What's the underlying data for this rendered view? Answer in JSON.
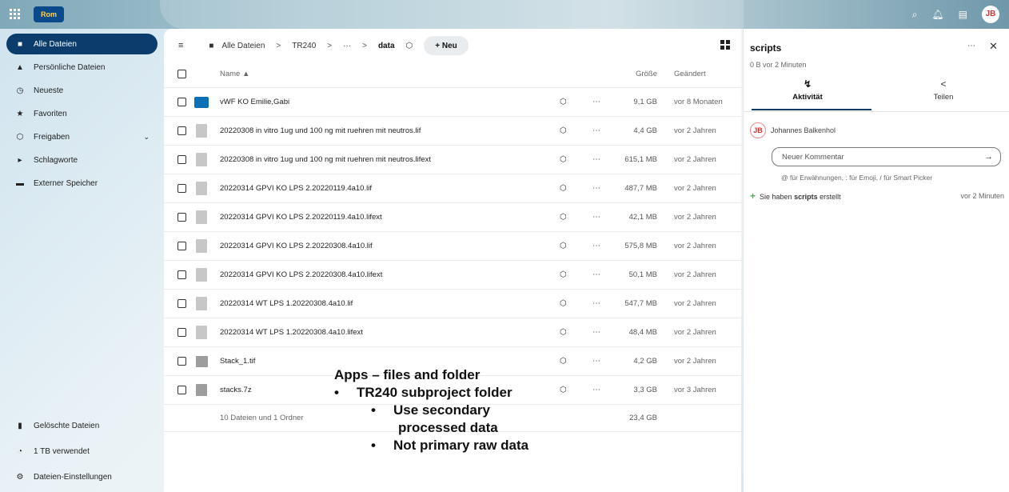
{
  "topbar": {
    "logo_text": "Rom",
    "avatar": "JB"
  },
  "sidebar": {
    "items": [
      {
        "label": "Alle Dateien",
        "icon": "folder-icon"
      },
      {
        "label": "Persönliche Dateien",
        "icon": "user-icon"
      },
      {
        "label": "Neueste",
        "icon": "history-icon"
      },
      {
        "label": "Favoriten",
        "icon": "star-icon"
      },
      {
        "label": "Freigaben",
        "icon": "share-icon"
      },
      {
        "label": "Schlagworte",
        "icon": "tag-icon"
      },
      {
        "label": "Externer Speicher",
        "icon": "server-icon"
      }
    ],
    "bottom": [
      {
        "label": "Gelöschte Dateien",
        "icon": "trash-icon"
      },
      {
        "label": "1 TB verwendet",
        "icon": "pie-icon"
      },
      {
        "label": "Dateien-Einstellungen",
        "icon": "gear-icon"
      }
    ]
  },
  "breadcrumb": {
    "root": "Alle Dateien",
    "sep": ">",
    "level1": "TR240",
    "ellipsis": "···",
    "current": "data",
    "new_label": "+ Neu"
  },
  "table": {
    "col_name": "Name ▲",
    "col_size": "Größe",
    "col_modified": "Geändert",
    "rows": [
      {
        "name": "vWF KO Emilie,Gabi",
        "size": "9,1 GB",
        "modified": "vor 8 Monaten",
        "type": "folder"
      },
      {
        "name": "20220308 in vitro 1ug und 100 ng mit ruehren mit neutros.lif",
        "size": "4,4 GB",
        "modified": "vor 2 Jahren",
        "type": "file"
      },
      {
        "name": "20220308 in vitro 1ug und 100 ng mit ruehren mit neutros.lifext",
        "size": "615,1 MB",
        "modified": "vor 2 Jahren",
        "type": "file"
      },
      {
        "name": "20220314 GPVI KO LPS 2.20220119.4a10.lif",
        "size": "487,7 MB",
        "modified": "vor 2 Jahren",
        "type": "file"
      },
      {
        "name": "20220314 GPVI KO LPS 2.20220119.4a10.lifext",
        "size": "42,1 MB",
        "modified": "vor 2 Jahren",
        "type": "file"
      },
      {
        "name": "20220314 GPVI KO LPS 2.20220308.4a10.lif",
        "size": "575,8 MB",
        "modified": "vor 2 Jahren",
        "type": "file"
      },
      {
        "name": "20220314 GPVI KO LPS 2.20220308.4a10.lifext",
        "size": "50,1 MB",
        "modified": "vor 2 Jahren",
        "type": "file"
      },
      {
        "name": "20220314 WT LPS 1.20220308.4a10.lif",
        "size": "547,7 MB",
        "modified": "vor 2 Jahren",
        "type": "file"
      },
      {
        "name": "20220314 WT LPS 1.20220308.4a10.lifext",
        "size": "48,4 MB",
        "modified": "vor 2 Jahren",
        "type": "file"
      },
      {
        "name": "Stack_1.tif",
        "size": "4,2 GB",
        "modified": "vor 2 Jahren",
        "type": "image"
      },
      {
        "name": "stacks.7z",
        "size": "3,3 GB",
        "modified": "vor 3 Jahren",
        "type": "archive"
      }
    ],
    "footer_summary": "10 Dateien und 1 Ordner",
    "footer_size": "23,4 GB"
  },
  "overlay": {
    "title": "Apps – files and folder",
    "bullet1": "TR240 subproject folder",
    "bullet2a": "Use secondary",
    "bullet2b": "processed data",
    "bullet3": "Not primary raw data"
  },
  "panel": {
    "title": "scripts",
    "subtitle": "0 B vor 2 Minuten",
    "tab_activity": "Aktivität",
    "tab_share": "Teilen",
    "user": "Johannes Balkenhol",
    "user_initials": "JB",
    "comment_placeholder": "Neuer Kommentar",
    "hint": "@ für Erwähnungen, : für Emoji, / für Smart Picker",
    "activity_prefix": "Sie haben ",
    "activity_bold": "scripts",
    "activity_suffix": " erstellt",
    "activity_time": "vor 2 Minuten"
  },
  "colors": {
    "primary": "#0b3c6b",
    "folder": "#0b70b3",
    "success": "#4caf50"
  }
}
